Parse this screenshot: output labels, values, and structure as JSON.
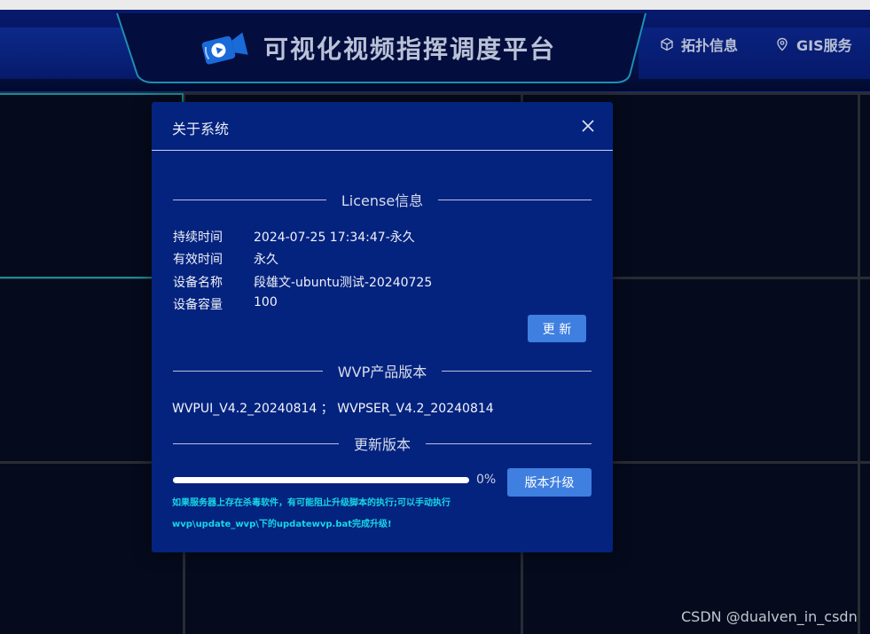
{
  "header": {
    "title": "可视化视频指挥调度平台",
    "nav": [
      {
        "label": "拓扑信息",
        "icon": "cube-icon"
      },
      {
        "label": "GIS服务",
        "icon": "location-pin-icon"
      }
    ]
  },
  "modal": {
    "title": "关于系统",
    "license_section": "License信息",
    "license_rows": [
      {
        "key": "持续时间",
        "value": "2024-07-25 17:34:47-永久"
      },
      {
        "key": "有效时间",
        "value": "永久"
      },
      {
        "key": "设备名称",
        "value": "段雄文-ubuntu测试-20240725"
      },
      {
        "key": "设备容量",
        "value": "100"
      }
    ],
    "update_button": "更 新",
    "product_section": "WVP产品版本",
    "version_text": "WVPUI_V4.2_20240814 ； WVPSER_V4.2_20240814",
    "upgrade_section": "更新版本",
    "progress_value": 0,
    "progress_label": "0%",
    "upgrade_button": "版本升级",
    "notice_line1": "如果服务器上存在杀毒软件，有可能阻止升级脚本的执行;可以手动执行",
    "notice_line2": "wvp\\update_wvp\\下的updatewvp.bat完成升级!"
  },
  "watermark": "CSDN @dualven_in_csdn",
  "colors": {
    "modal_bg": "#04237f",
    "button": "#3f7fe0",
    "notice": "#17d6e6"
  }
}
